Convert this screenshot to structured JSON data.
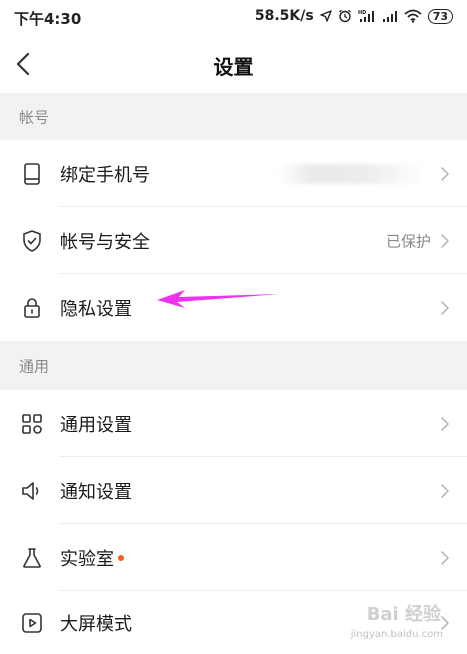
{
  "status_bar": {
    "time": "下午4:30",
    "speed": "58.5K/s",
    "battery": "73",
    "hd_label": "HD"
  },
  "header": {
    "title": "设置"
  },
  "sections": [
    {
      "header": "帐号",
      "items": [
        {
          "label": "绑定手机号",
          "icon": "phone-icon",
          "value": ""
        },
        {
          "label": "帐号与安全",
          "icon": "shield-check-icon",
          "value": "已保护"
        },
        {
          "label": "隐私设置",
          "icon": "lock-icon",
          "value": ""
        }
      ]
    },
    {
      "header": "通用",
      "items": [
        {
          "label": "通用设置",
          "icon": "grid-icon",
          "value": ""
        },
        {
          "label": "通知设置",
          "icon": "speaker-icon",
          "value": ""
        },
        {
          "label": "实验室",
          "icon": "flask-icon",
          "value": "",
          "has_new_dot": true
        },
        {
          "label": "大屏模式",
          "icon": "play-square-icon",
          "value": ""
        }
      ]
    }
  ],
  "colors": {
    "annotation_arrow": "#ee33ee",
    "new_dot": "#ff5a1f",
    "section_bg": "#f2f2f2",
    "secondary_text": "#8a8a8a"
  },
  "watermark": {
    "text": "Bai 经验",
    "url": "jingyan.baidu.com"
  }
}
